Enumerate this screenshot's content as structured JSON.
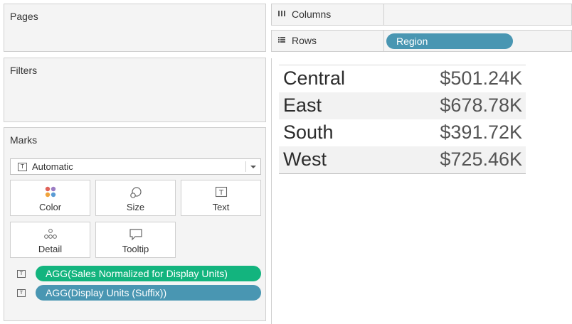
{
  "cards": {
    "pages": "Pages",
    "filters": "Filters",
    "marks": "Marks"
  },
  "marks": {
    "type": "Automatic",
    "buttons": [
      "Color",
      "Size",
      "Text",
      "Detail",
      "Tooltip"
    ],
    "pills": [
      {
        "label": "AGG(Sales Normalized for Display Units)",
        "color": "#13b47e"
      },
      {
        "label": "AGG(Display Units (Suffix))",
        "color": "#4996b2"
      }
    ]
  },
  "shelves": {
    "columns": "Columns",
    "rows": "Rows",
    "rows_pill": "Region"
  },
  "table": {
    "rows": [
      {
        "name": "Central",
        "value": "$501.24K"
      },
      {
        "name": "East",
        "value": "$678.78K"
      },
      {
        "name": "South",
        "value": "$391.72K"
      },
      {
        "name": "West",
        "value": "$725.46K"
      }
    ]
  },
  "colors": {
    "rows_pill": "#4996b2",
    "measure_pill": "#13b47e",
    "panel_bg": "#f4f4f4"
  }
}
